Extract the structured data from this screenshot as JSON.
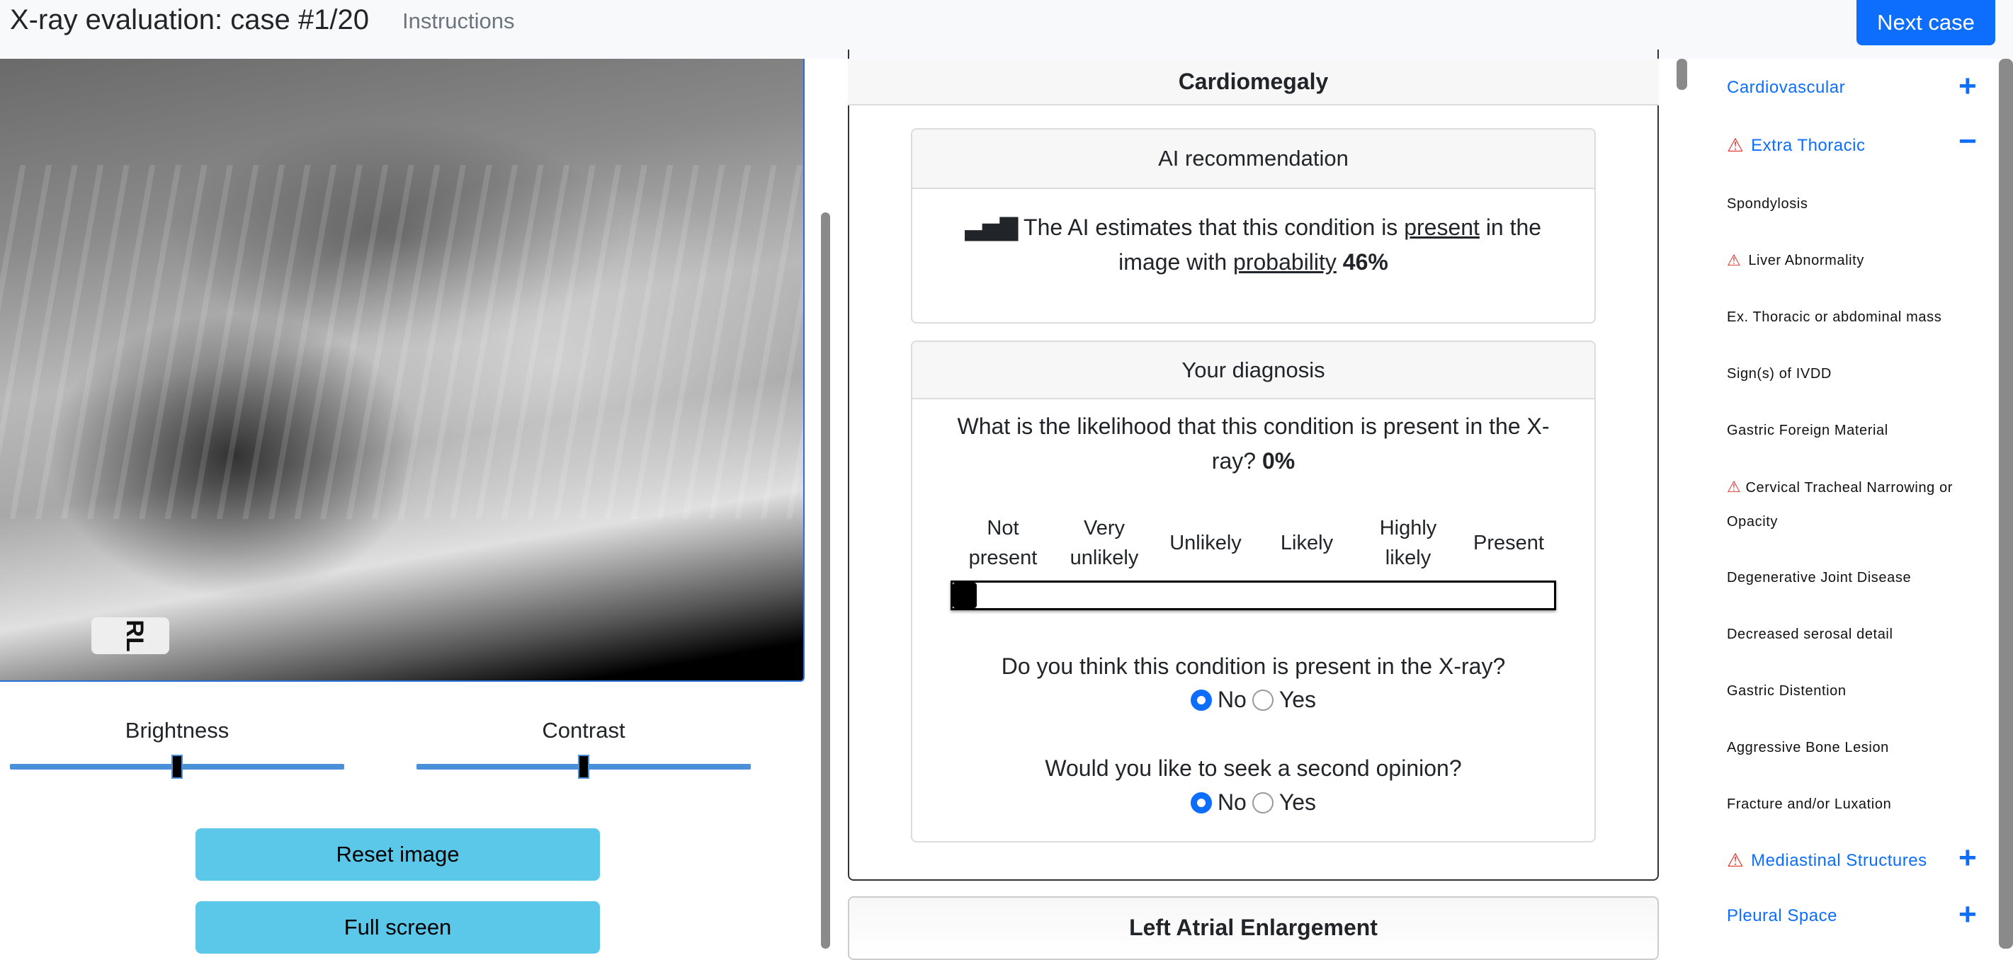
{
  "header": {
    "title": "X-ray evaluation: case #1/20",
    "instructions": "Instructions",
    "next_case": "Next case"
  },
  "image": {
    "marker": "RL"
  },
  "controls": {
    "brightness": "Brightness",
    "contrast": "Contrast",
    "brightness_value": 0.5,
    "contrast_value": 0.5,
    "reset": "Reset image",
    "fullscreen": "Full screen"
  },
  "condition": {
    "title": "Cardiomegaly",
    "ai": {
      "header": "AI recommendation",
      "text_pre": "The AI estimates that this condition is",
      "present": "present",
      "text_mid": "in the image with",
      "probability_label": "probability",
      "probability": "46%"
    },
    "diagnosis": {
      "header": "Your diagnosis",
      "question": "What is the likelihood that this condition is present in the X-ray?",
      "likelihood": "0%",
      "likelihood_value": 0,
      "scale": [
        "Not present",
        "Very unlikely",
        "Unlikely",
        "Likely",
        "Highly likely",
        "Present"
      ],
      "present_q": "Do you think this condition is present in the X-ray?",
      "second_q": "Would you like to seek a second opinion?",
      "no": "No",
      "yes": "Yes",
      "present_answer": "No",
      "second_answer": "No"
    }
  },
  "next_condition": {
    "title": "Left Atrial Enlargement"
  },
  "sidebar": {
    "cardiovascular": "Cardiovascular",
    "extra_thoracic": "Extra Thoracic",
    "items": [
      "Spondylosis",
      "Liver Abnormality",
      "Ex. Thoracic or abdominal mass",
      "Sign(s) of IVDD",
      "Gastric Foreign Material",
      "Cervical Tracheal Narrowing or Opacity",
      "Degenerative Joint Disease",
      "Decreased serosal detail",
      "Gastric Distention",
      "Aggressive Bone Lesion",
      "Fracture and/or Luxation"
    ],
    "mediastinal": "Mediastinal Structures",
    "pleural": "Pleural Space"
  },
  "colors": {
    "primary": "#0d6efd",
    "info": "#5bc8ea",
    "warning": "#e0322b"
  }
}
